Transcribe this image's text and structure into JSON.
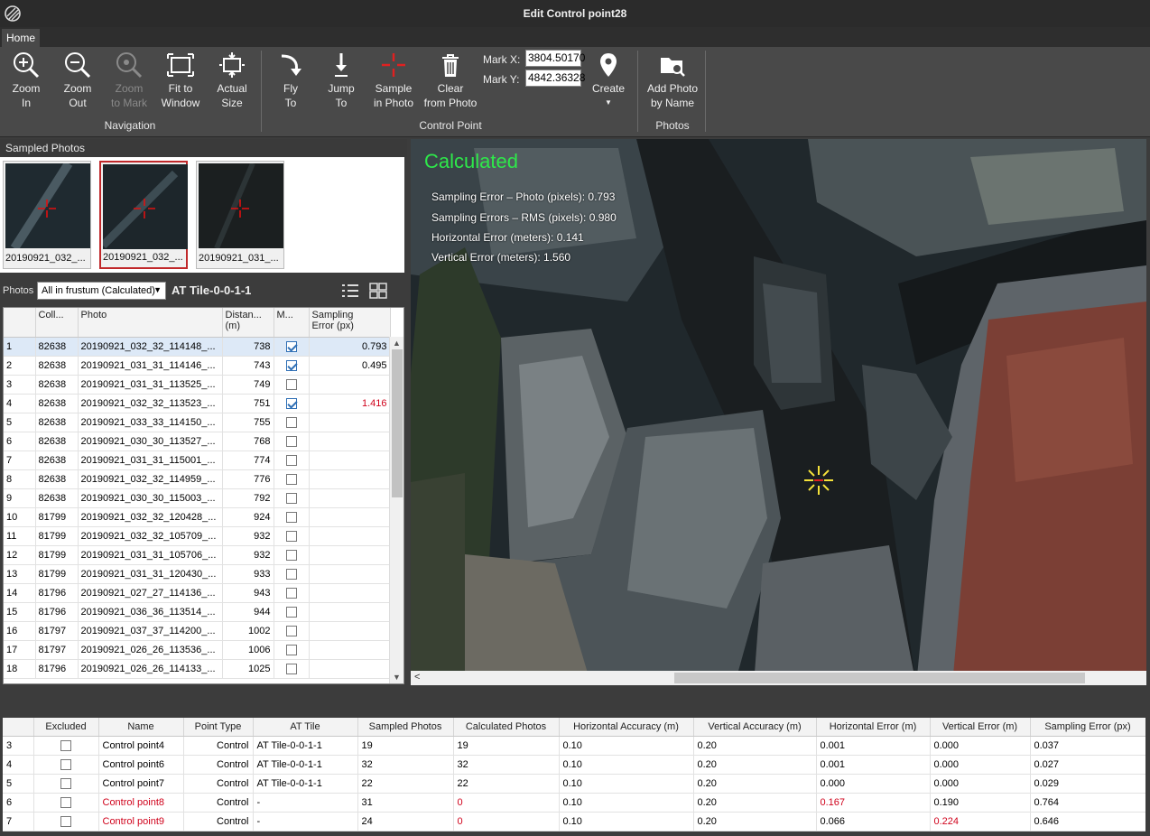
{
  "window": {
    "title": "Edit Control point28"
  },
  "tabs": [
    {
      "label": "Home"
    }
  ],
  "ribbon": {
    "zoom_in": "Zoom\nIn",
    "zoom_out": "Zoom\nOut",
    "zoom_to_mark": "Zoom\nto Mark",
    "fit_to_window": "Fit to\nWindow",
    "actual_size": "Actual\nSize",
    "navigation_group": "Navigation",
    "fly_to": "Fly\nTo",
    "jump_to": "Jump\nTo",
    "sample_in_photo": "Sample\nin Photo",
    "clear_from_photo": "Clear\nfrom Photo",
    "mark_x_label": "Mark X:",
    "mark_x_value": "3804.50170",
    "mark_y_label": "Mark Y:",
    "mark_y_value": "4842.36328",
    "create": "Create",
    "control_point_group": "Control Point",
    "add_photo_by_name": "Add Photo\nby Name",
    "photos_group": "Photos"
  },
  "sampled_photos": {
    "header": "Sampled Photos",
    "thumbnails": [
      {
        "caption": "20190921_032_..."
      },
      {
        "caption": "20190921_032_..."
      },
      {
        "caption": "20190921_031_..."
      }
    ]
  },
  "photos_bar": {
    "label": "Photos",
    "filter_value": "All in frustum (Calculated)",
    "tile": "AT Tile-0-0-1-1"
  },
  "photos_table": {
    "columns": [
      "",
      "Coll...",
      "Photo",
      "Distan...\n(m)",
      "M...",
      "Sampling\nError (px)"
    ],
    "rows": [
      {
        "idx": "1",
        "coll": "82638",
        "photo": "20190921_032_32_114148_...",
        "dist": "738",
        "checked": true,
        "error": "0.793"
      },
      {
        "idx": "2",
        "coll": "82638",
        "photo": "20190921_031_31_114146_...",
        "dist": "743",
        "checked": true,
        "error": "0.495"
      },
      {
        "idx": "3",
        "coll": "82638",
        "photo": "20190921_031_31_113525_...",
        "dist": "749",
        "checked": false,
        "error": ""
      },
      {
        "idx": "4",
        "coll": "82638",
        "photo": "20190921_032_32_113523_...",
        "dist": "751",
        "checked": true,
        "error": "1.416"
      },
      {
        "idx": "5",
        "coll": "82638",
        "photo": "20190921_033_33_114150_...",
        "dist": "755",
        "checked": false,
        "error": ""
      },
      {
        "idx": "6",
        "coll": "82638",
        "photo": "20190921_030_30_113527_...",
        "dist": "768",
        "checked": false,
        "error": ""
      },
      {
        "idx": "7",
        "coll": "82638",
        "photo": "20190921_031_31_115001_...",
        "dist": "774",
        "checked": false,
        "error": ""
      },
      {
        "idx": "8",
        "coll": "82638",
        "photo": "20190921_032_32_114959_...",
        "dist": "776",
        "checked": false,
        "error": ""
      },
      {
        "idx": "9",
        "coll": "82638",
        "photo": "20190921_030_30_115003_...",
        "dist": "792",
        "checked": false,
        "error": ""
      },
      {
        "idx": "10",
        "coll": "81799",
        "photo": "20190921_032_32_120428_...",
        "dist": "924",
        "checked": false,
        "error": ""
      },
      {
        "idx": "11",
        "coll": "81799",
        "photo": "20190921_032_32_105709_...",
        "dist": "932",
        "checked": false,
        "error": ""
      },
      {
        "idx": "12",
        "coll": "81799",
        "photo": "20190921_031_31_105706_...",
        "dist": "932",
        "checked": false,
        "error": ""
      },
      {
        "idx": "13",
        "coll": "81799",
        "photo": "20190921_031_31_120430_...",
        "dist": "933",
        "checked": false,
        "error": ""
      },
      {
        "idx": "14",
        "coll": "81796",
        "photo": "20190921_027_27_114136_...",
        "dist": "943",
        "checked": false,
        "error": ""
      },
      {
        "idx": "15",
        "coll": "81796",
        "photo": "20190921_036_36_113514_...",
        "dist": "944",
        "checked": false,
        "error": ""
      },
      {
        "idx": "16",
        "coll": "81797",
        "photo": "20190921_037_37_114200_...",
        "dist": "1002",
        "checked": false,
        "error": ""
      },
      {
        "idx": "17",
        "coll": "81797",
        "photo": "20190921_026_26_113536_...",
        "dist": "1006",
        "checked": false,
        "error": ""
      },
      {
        "idx": "18",
        "coll": "81796",
        "photo": "20190921_026_26_114133_...",
        "dist": "1025",
        "checked": false,
        "error": ""
      }
    ]
  },
  "viewer": {
    "status": "Calculated",
    "lines": [
      "Sampling Error – Photo (pixels): 0.793",
      "Sampling Errors – RMS (pixels): 0.980",
      "Horizontal Error (meters): 0.141",
      "Vertical Error (meters): 1.560"
    ]
  },
  "control_points_table": {
    "columns": [
      "",
      "Excluded",
      "Name",
      "Point Type",
      "AT Tile",
      "Sampled Photos",
      "Calculated Photos",
      "Horizontal Accuracy (m)",
      "Vertical Accuracy (m)",
      "Horizontal Error (m)",
      "Vertical Error (m)",
      "Sampling Error (px)"
    ],
    "rows": [
      {
        "idx": "3",
        "name": "Control point4",
        "type": "Control",
        "tile": "AT Tile-0-0-1-1",
        "sampled": "19",
        "calculated": "19",
        "hacc": "0.10",
        "vacc": "0.20",
        "herr": "0.001",
        "verr": "0.000",
        "serr": "0.037",
        "name_red": false,
        "calc_red": false,
        "herr_red": false,
        "verr_red": false
      },
      {
        "idx": "4",
        "name": "Control point6",
        "type": "Control",
        "tile": "AT Tile-0-0-1-1",
        "sampled": "32",
        "calculated": "32",
        "hacc": "0.10",
        "vacc": "0.20",
        "herr": "0.001",
        "verr": "0.000",
        "serr": "0.027",
        "name_red": false,
        "calc_red": false,
        "herr_red": false,
        "verr_red": false
      },
      {
        "idx": "5",
        "name": "Control point7",
        "type": "Control",
        "tile": "AT Tile-0-0-1-1",
        "sampled": "22",
        "calculated": "22",
        "hacc": "0.10",
        "vacc": "0.20",
        "herr": "0.000",
        "verr": "0.000",
        "serr": "0.029",
        "name_red": false,
        "calc_red": false,
        "herr_red": false,
        "verr_red": false
      },
      {
        "idx": "6",
        "name": "Control point8",
        "type": "Control",
        "tile": "-",
        "sampled": "31",
        "calculated": "0",
        "hacc": "0.10",
        "vacc": "0.20",
        "herr": "0.167",
        "verr": "0.190",
        "serr": "0.764",
        "name_red": true,
        "calc_red": true,
        "herr_red": true,
        "verr_red": false
      },
      {
        "idx": "7",
        "name": "Control point9",
        "type": "Control",
        "tile": "-",
        "sampled": "24",
        "calculated": "0",
        "hacc": "0.10",
        "vacc": "0.20",
        "herr": "0.066",
        "verr": "0.224",
        "serr": "0.646",
        "name_red": true,
        "calc_red": true,
        "herr_red": false,
        "verr_red": true
      }
    ]
  },
  "colors": {
    "accent_green": "#2ee84a",
    "error_red": "#d0021b",
    "selection_red": "#c0282a"
  }
}
